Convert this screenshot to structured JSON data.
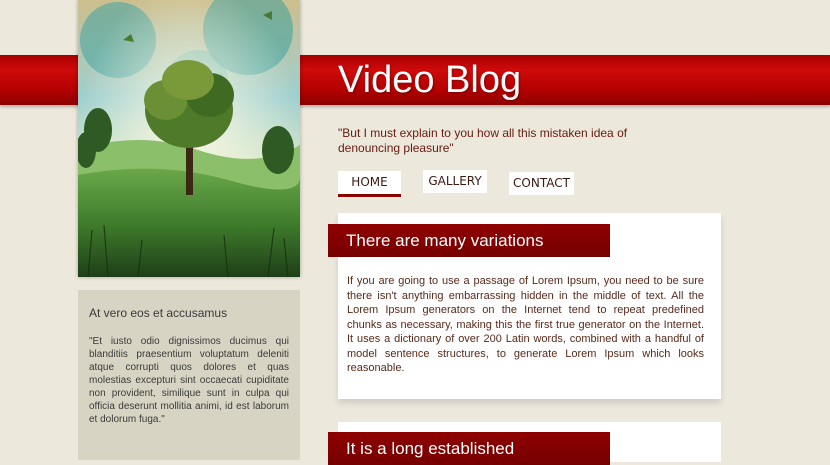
{
  "header": {
    "title": "Video Blog",
    "tagline": "\"But I must explain to you how all this mistaken idea of denouncing pleasure\""
  },
  "nav": {
    "items": [
      {
        "label": "HOME",
        "active": true
      },
      {
        "label": "GALLERY",
        "active": false
      },
      {
        "label": "CONTACT",
        "active": false
      }
    ]
  },
  "sidebar": {
    "title": "At vero eos et accusamus",
    "text": "\"Et iusto odio dignissimos ducimus qui blanditiis praesentium voluptatum deleniti atque corrupti quos dolores et quas molestias excepturi sint occaecati cupiditate non provident, similique sunt in culpa qui officia deserunt mollitia animi, id est laborum et dolorum fuga.\""
  },
  "posts": [
    {
      "title": "There are many variations",
      "body": "If you are going to use a passage of Lorem Ipsum, you need to be sure there isn't anything embarrassing hidden in the middle of text. All the Lorem Ipsum generators on the Internet tend to repeat predefined chunks as necessary, making this the first true generator on the Internet. It uses a dictionary of over 200 Latin words, combined with a handful of model sentence structures, to generate Lorem Ipsum which looks reasonable."
    },
    {
      "title": "It is a long established"
    }
  ],
  "colors": {
    "background": "#ece8dc",
    "accent_red": "#c00000",
    "ribbon": "#800000",
    "sidebar_bg": "#d8d4c4"
  },
  "icons": {
    "hero": "tree-landscape-illustration"
  }
}
